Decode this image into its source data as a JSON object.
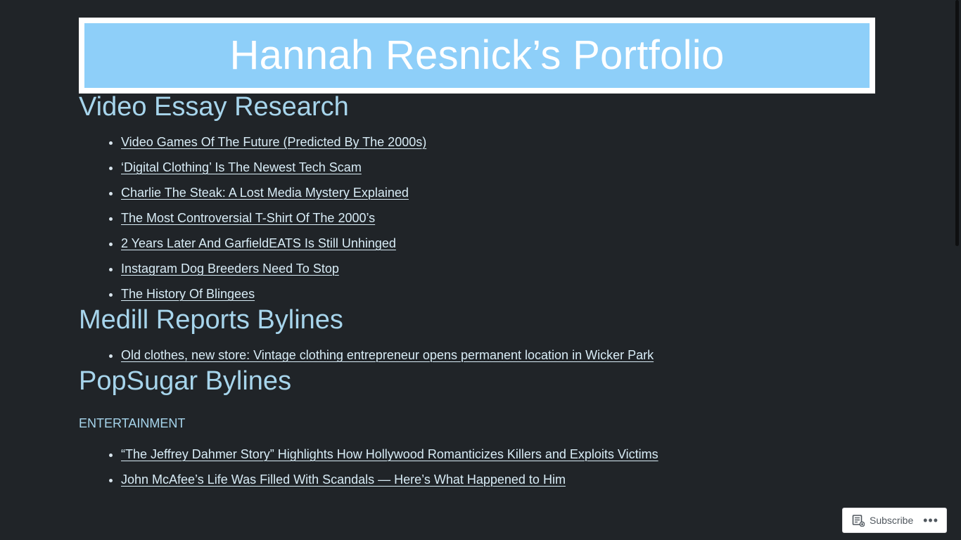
{
  "site": {
    "title": "Hannah Resnick’s Portfolio"
  },
  "sections": [
    {
      "title": "Video Essay Research",
      "links": [
        "Video Games Of The Future (Predicted By The 2000s)",
        "‘Digital Clothing’ Is The Newest Tech Scam",
        "Charlie The Steak: A Lost Media Mystery Explained",
        "The Most Controversial T-Shirt Of The 2000’s",
        "2 Years Later And GarfieldEATS Is Still Unhinged",
        "Instagram Dog Breeders Need To Stop",
        "The History Of Blingees"
      ]
    },
    {
      "title": "Medill Reports Bylines",
      "links": [
        "Old clothes, new store: Vintage clothing entrepreneur opens permanent location in Wicker Park"
      ]
    },
    {
      "title": "PopSugar Bylines",
      "category": "ENTERTAINMENT",
      "links": [
        "“The Jeffrey Dahmer Story” Highlights How Hollywood Romanticizes Killers and Exploits Victims ",
        "John McAfee’s Life Was Filled With Scandals — Here’s What Happened to Him"
      ]
    }
  ],
  "subscribe_bar": {
    "subscribe_label": "Subscribe",
    "icon": "reader-icon",
    "more_label": "•••",
    "more_icon": "more-options-icon"
  },
  "colors": {
    "background": "#202428",
    "header_fill": "#8ecff9",
    "heading": "#a7d5ec",
    "link": "#d8ecf6"
  }
}
